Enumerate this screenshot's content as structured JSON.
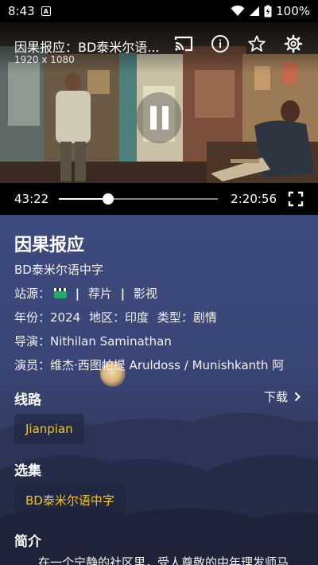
{
  "status_bar": {
    "time": "8:43",
    "notification_icon": "A",
    "battery": "100%"
  },
  "player": {
    "title": "因果报应：BD泰米尔语...",
    "resolution": "1920 x 1080",
    "current_time": "43:22",
    "total_time": "2:20:56",
    "progress": 0.3075,
    "state": "playing",
    "icons": [
      "cast-icon",
      "info-icon",
      "star-icon",
      "settings-icon",
      "pause-icon",
      "fullscreen-icon"
    ]
  },
  "details": {
    "title": "因果报应",
    "subtitle": "BD泰米尔语中字",
    "source": {
      "label": "站源：",
      "icon": "clapperboard-icon",
      "separator": "|",
      "items": [
        "荐片",
        "影视"
      ]
    },
    "meta": {
      "year_label": "年份：",
      "year": "2024",
      "region_label": "地区：",
      "region": "印度",
      "genre_label": "类型：",
      "genre": "剧情"
    },
    "director_label": "导演：",
    "director": "Nithilan Saminathan",
    "cast_label": "演员：",
    "cast": "维杰·西图帕提 Aruldoss / Munishkanth 阿",
    "routes_title": "线路",
    "download_label": "下载",
    "route": "Jianpian",
    "episodes_title": "选集",
    "episode": "BD泰米尔语中字",
    "synopsis_title": "简介",
    "synopsis_start": "在一个宁静的社区里，受人尊敬的中年理发师马"
  },
  "colors": {
    "accent": "#f2c230",
    "background_top": "#3d4a7e",
    "background_bottom": "#242a40"
  }
}
